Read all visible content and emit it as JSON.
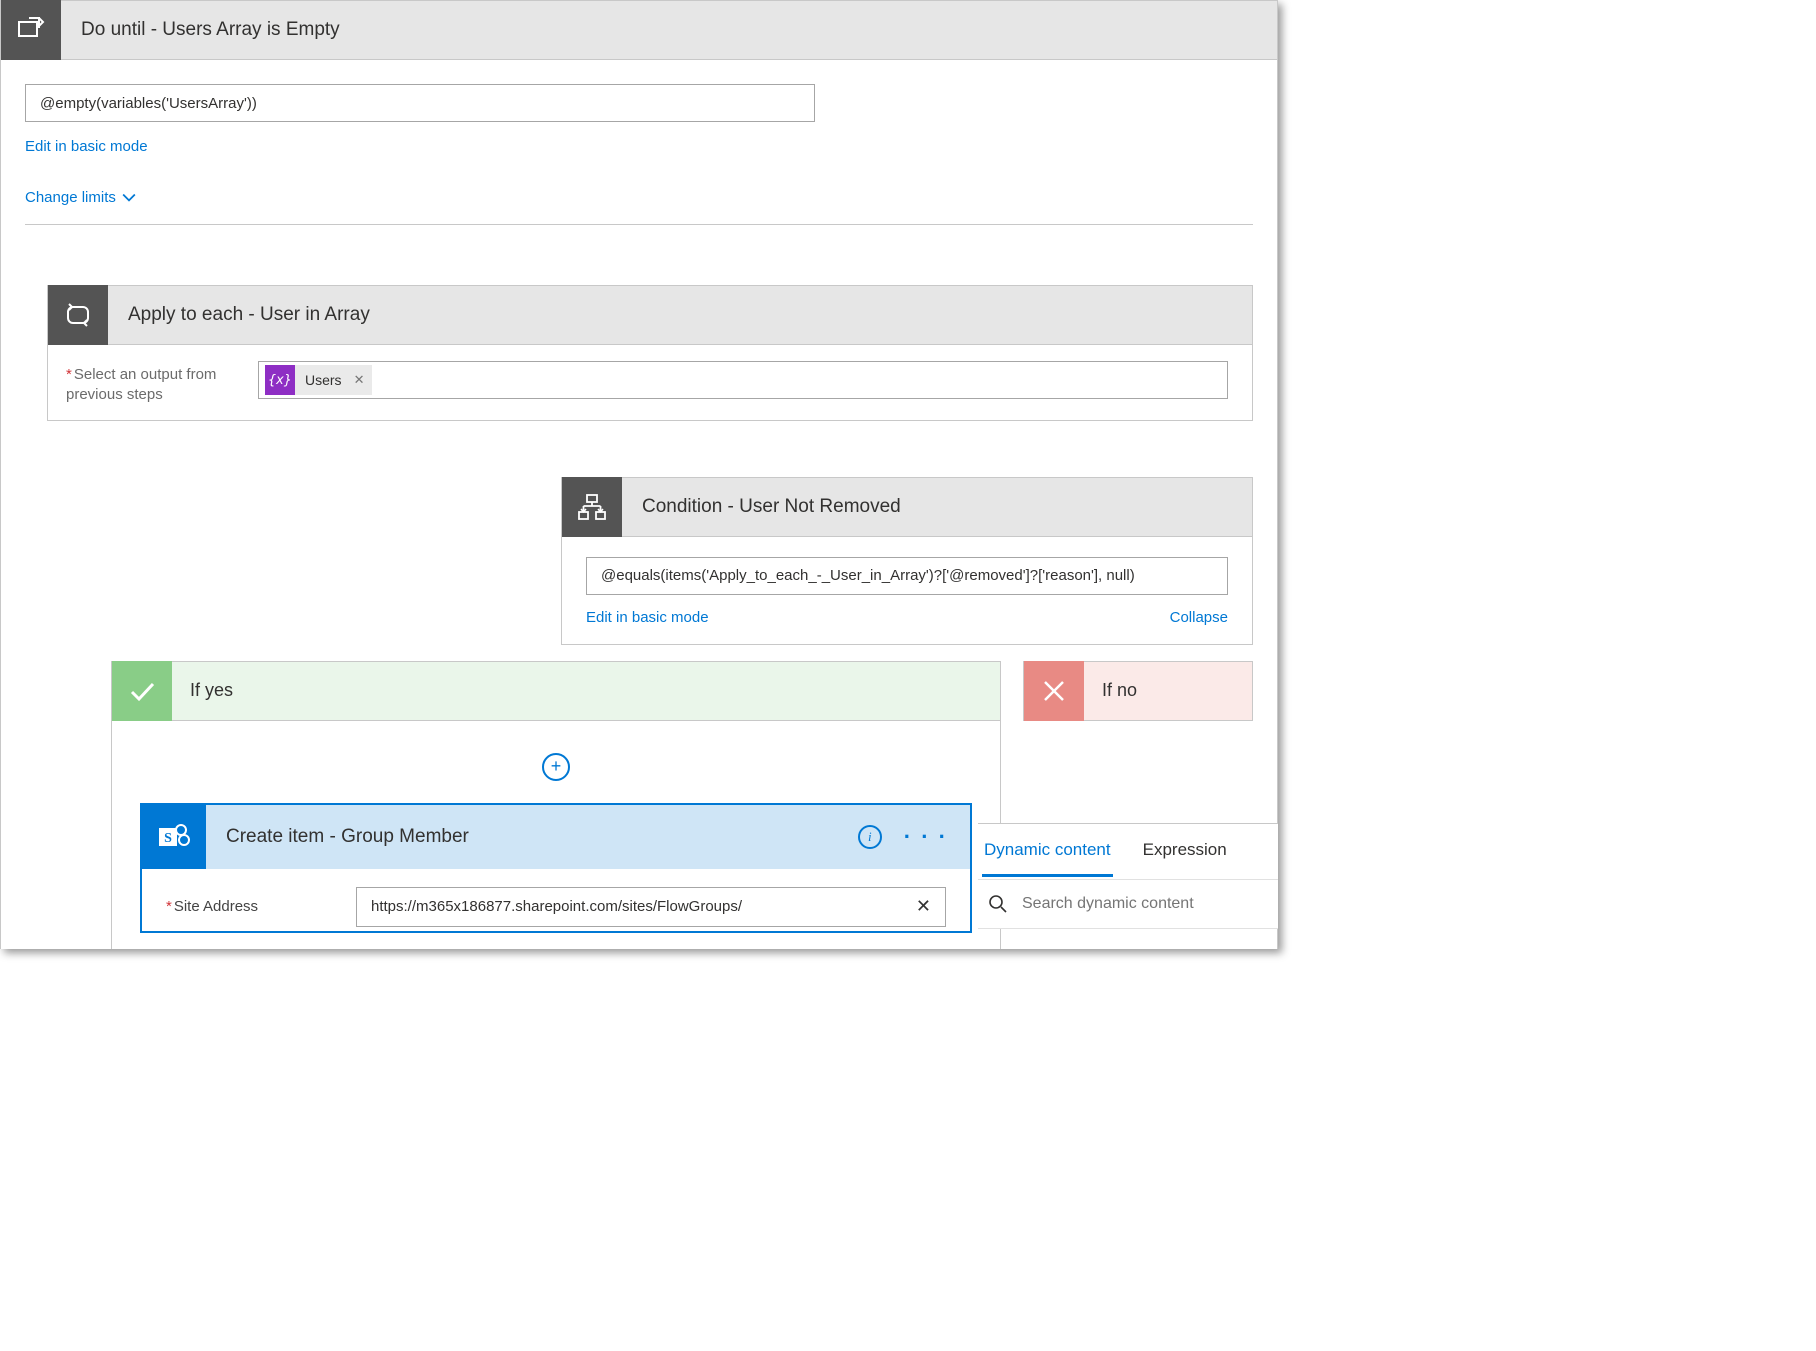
{
  "doUntil": {
    "title": "Do until - Users Array is Empty",
    "expression": "@empty(variables('UsersArray'))",
    "editLink": "Edit in basic mode",
    "changeLimits": "Change limits"
  },
  "applyEach": {
    "title": "Apply to each - User in Array",
    "fieldLabel": "Select an output from previous steps",
    "tokenName": "Users"
  },
  "condition": {
    "title": "Condition - User Not Removed",
    "expression": "@equals(items('Apply_to_each_-_User_in_Array')?['@removed']?['reason'], null)",
    "editLink": "Edit in basic mode",
    "collapseLink": "Collapse"
  },
  "branches": {
    "yesLabel": "If yes",
    "noLabel": "If no"
  },
  "createItem": {
    "title": "Create item - Group Member",
    "siteAddressLabel": "Site Address",
    "siteAddressValue": "https://m365x186877.sharepoint.com/sites/FlowGroups/"
  },
  "dynamic": {
    "tabDynamic": "Dynamic content",
    "tabExpression": "Expression",
    "searchPlaceholder": "Search dynamic content"
  }
}
